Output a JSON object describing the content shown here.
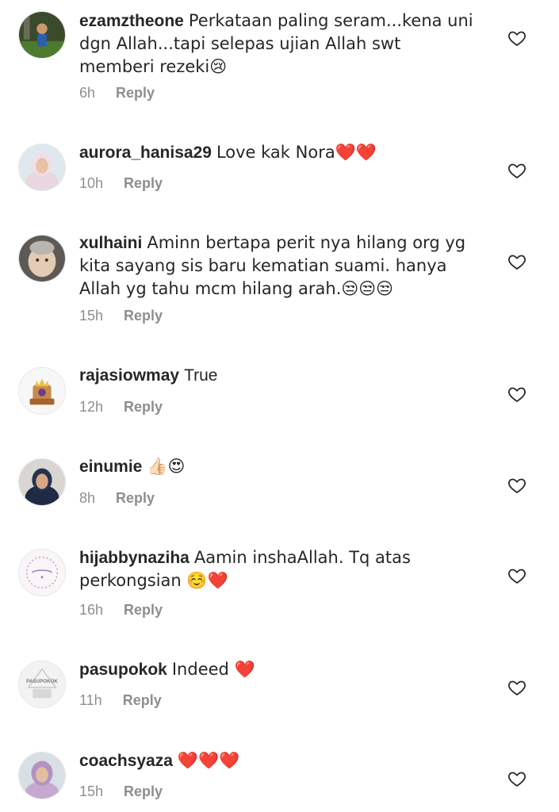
{
  "comments": [
    {
      "user": "ezamztheone",
      "text": "Perkataan paling seram...kena uni dgn Allah...tapi selepas ujian Allah swt memberi rezeki😢",
      "time": "6h",
      "reply": "Reply"
    },
    {
      "user": "aurora_hanisa29",
      "text": "Love kak Nora❤️❤️",
      "time": "10h",
      "reply": "Reply"
    },
    {
      "user": "xulhaini",
      "text": "Aminn bertapa perit nya hilang org yg kita sayang sis baru kematian suami. hanya Allah yg tahu mcm hilang arah.😒😒😒",
      "time": "15h",
      "reply": "Reply"
    },
    {
      "user": "rajasiowmay",
      "text": "True",
      "time": "12h",
      "reply": "Reply"
    },
    {
      "user": "einumie",
      "text": "👍🏻😍",
      "time": "8h",
      "reply": "Reply"
    },
    {
      "user": "hijabbynaziha",
      "text": "Aamin inshaAllah. Tq atas perkongsian ☺️❤️",
      "time": "16h",
      "reply": "Reply"
    },
    {
      "user": "pasupokok",
      "text": "Indeed ❤️",
      "time": "11h",
      "reply": "Reply"
    },
    {
      "user": "coachsyaza",
      "text": "❤️❤️❤️",
      "time": "15h",
      "reply": "Reply"
    }
  ],
  "avatar_labels": {
    "pasupokok": "PASUPOKOK"
  },
  "colors": {
    "text": "#262626",
    "meta": "#8e8e8e",
    "heart_outline": "#262626"
  }
}
